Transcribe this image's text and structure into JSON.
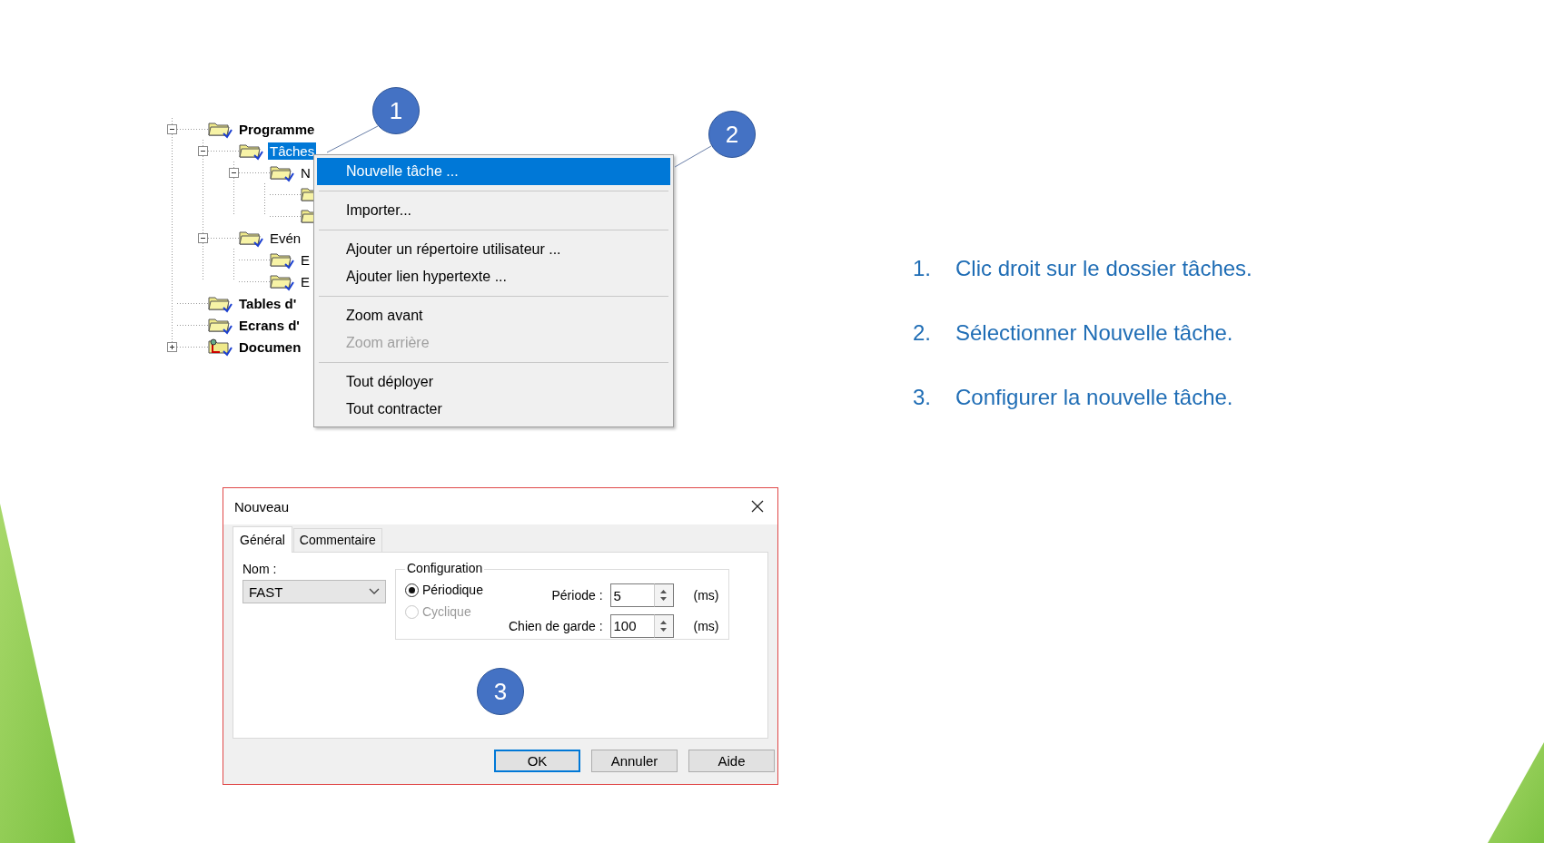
{
  "tree": {
    "items": [
      {
        "label": "Programme",
        "kind": "folder",
        "expanded": true,
        "selected": false,
        "children": [
          {
            "label": "Tâches",
            "kind": "folder",
            "expanded": true,
            "selected": true,
            "children": [
              {
                "label": "N",
                "kind": "folder",
                "expanded": true,
                "selected": false,
                "children": [
                  {
                    "kind": "folder"
                  },
                  {
                    "kind": "folder"
                  }
                ]
              }
            ]
          },
          {
            "label": "Evén",
            "kind": "folder",
            "expanded": true,
            "selected": false,
            "children": [
              {
                "label": "E",
                "kind": "folder",
                "selected": false
              },
              {
                "label": "E",
                "kind": "folder",
                "selected": false
              }
            ]
          }
        ]
      },
      {
        "label": "Tables d'",
        "kind": "folder",
        "selected": false
      },
      {
        "label": "Ecrans d'",
        "kind": "folder",
        "selected": false
      },
      {
        "label": "Documen",
        "kind": "document",
        "expanded": false,
        "selected": false
      }
    ]
  },
  "context_menu": {
    "groups": [
      {
        "items": [
          {
            "label": "Nouvelle tâche ...",
            "selected": true,
            "disabled": false
          }
        ]
      },
      {
        "items": [
          {
            "label": "Importer...",
            "selected": false,
            "disabled": false
          }
        ]
      },
      {
        "items": [
          {
            "label": "Ajouter un répertoire utilisateur ...",
            "selected": false,
            "disabled": false
          },
          {
            "label": "Ajouter lien hypertexte ...",
            "selected": false,
            "disabled": false
          }
        ]
      },
      {
        "items": [
          {
            "label": "Zoom avant",
            "selected": false,
            "disabled": false
          },
          {
            "label": "Zoom arrière",
            "selected": false,
            "disabled": true
          }
        ]
      },
      {
        "items": [
          {
            "label": "Tout déployer",
            "selected": false,
            "disabled": false
          },
          {
            "label": "Tout contracter",
            "selected": false,
            "disabled": false
          }
        ]
      }
    ]
  },
  "dialog": {
    "title": "Nouveau",
    "tabs": [
      {
        "label": "Général",
        "selected": true
      },
      {
        "label": "Commentaire",
        "selected": false
      }
    ],
    "name_label": "Nom :",
    "name_value": "FAST",
    "configuration": {
      "title": "Configuration",
      "options": [
        {
          "label": "Périodique",
          "selected": true,
          "disabled": false
        },
        {
          "label": "Cyclique",
          "selected": false,
          "disabled": true
        }
      ],
      "fields": [
        {
          "label": "Période :",
          "value": "5",
          "unit": "(ms)"
        },
        {
          "label": "Chien de garde :",
          "value": "100",
          "unit": "(ms)"
        }
      ]
    },
    "buttons": [
      {
        "label": "OK",
        "default": true
      },
      {
        "label": "Annuler",
        "default": false
      },
      {
        "label": "Aide",
        "default": false
      }
    ]
  },
  "callouts": [
    {
      "number": "1"
    },
    {
      "number": "2"
    },
    {
      "number": "3"
    }
  ],
  "steps": [
    {
      "number": "1.",
      "text": "Clic droit sur le dossier tâches."
    },
    {
      "number": "2.",
      "text": "Sélectionner Nouvelle tâche."
    },
    {
      "number": "3.",
      "text": "Configurer la nouvelle tâche."
    }
  ]
}
